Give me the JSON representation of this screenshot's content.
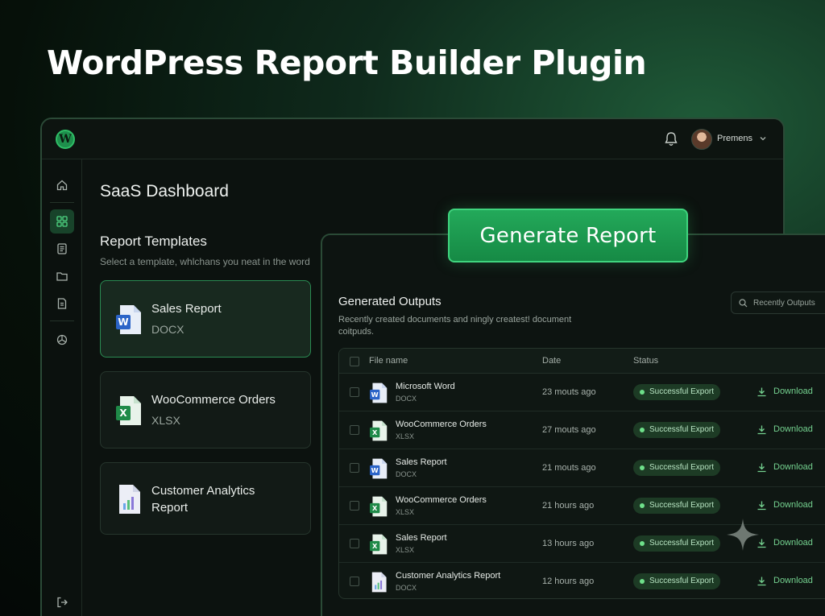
{
  "hero": {
    "title": "WordPress Report Builder Plugin"
  },
  "topbar": {
    "user_name": "Premens"
  },
  "dashboard": {
    "title": "SaaS Dashboard",
    "templates_title": "Report Templates",
    "templates_subtitle": "Select a template, whlchans you neat in the word"
  },
  "templates": [
    {
      "name": "Sales Report",
      "type": "DOCX",
      "icon": "word-file-icon"
    },
    {
      "name": "WooCommerce Orders",
      "type": "XLSX",
      "icon": "excel-file-icon"
    },
    {
      "name": "Customer Analytics Report",
      "type": "",
      "icon": "analytics-file-icon"
    }
  ],
  "generate_button": {
    "label": "Generate Report"
  },
  "outputs": {
    "title": "Generated Outputs",
    "subtitle": "Recently created documents and ningly createst! document coitpuds.",
    "search_placeholder": "Recently Outputs",
    "columns": {
      "file": "File name",
      "date": "Date",
      "status": "Status"
    },
    "rows": [
      {
        "name": "Microsoft Word",
        "type": "DOCX",
        "date": "23 mouts ago",
        "status": "Successful Export",
        "action": "Download",
        "icon": "word-file-icon"
      },
      {
        "name": "WooCommerce Orders",
        "type": "XLSX",
        "date": "27 mouts ago",
        "status": "Successful Export",
        "action": "Download",
        "icon": "excel-file-icon"
      },
      {
        "name": "Sales Report",
        "type": "DOCX",
        "date": "21 mouts ago",
        "status": "Successful Export",
        "action": "Download",
        "icon": "word-file-icon"
      },
      {
        "name": "WooCommerce Orders",
        "type": "XLSX",
        "date": "21 hours ago",
        "status": "Successful Export",
        "action": "Download",
        "icon": "excel-file-icon"
      },
      {
        "name": "Sales Report",
        "type": "XLSX",
        "date": "13 hours ago",
        "status": "Successful Export",
        "action": "Download",
        "icon": "excel-file-icon"
      },
      {
        "name": "Customer Analytics Report",
        "type": "DOCX",
        "date": "12 hours ago",
        "status": "Successful Export",
        "action": "Download",
        "icon": "analytics-file-icon"
      }
    ]
  },
  "colors": {
    "accent": "#23a95a",
    "background": "#0c120f",
    "success": "#6ee08a"
  }
}
